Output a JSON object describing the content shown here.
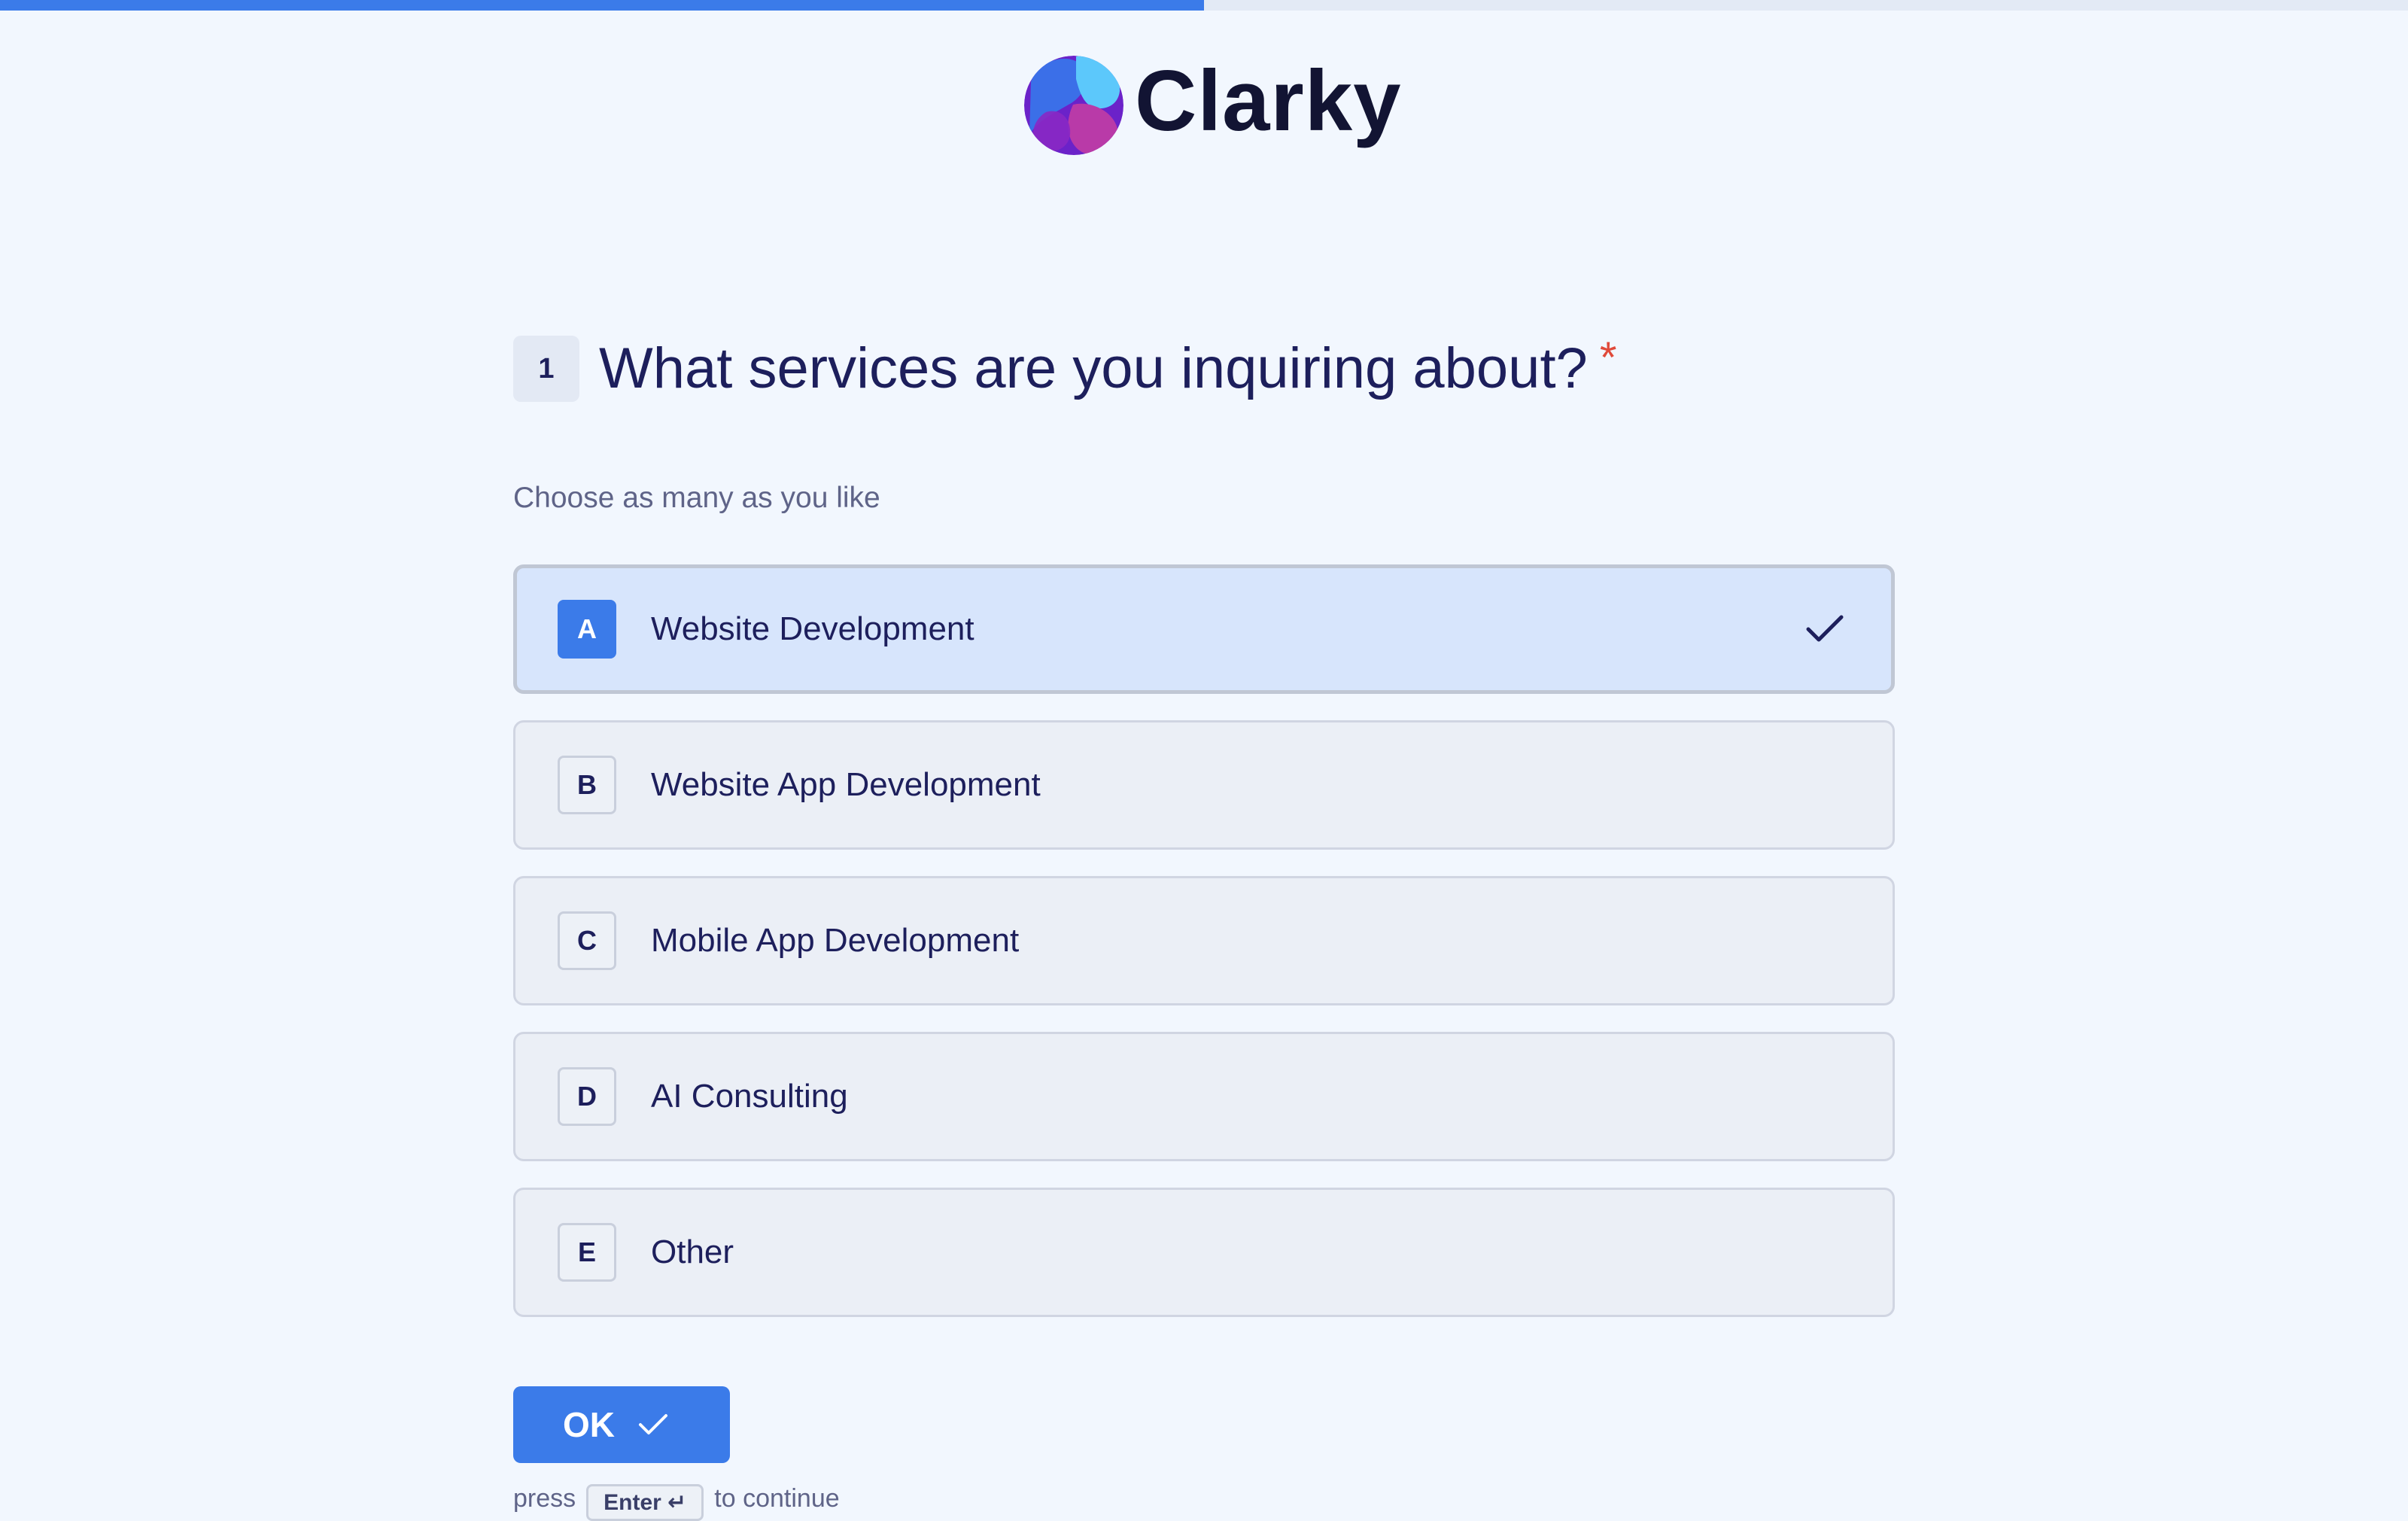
{
  "progress": {
    "fraction": 0.5
  },
  "brand": {
    "name": "Clarky",
    "logo_icon": "clarky-logo-mark",
    "logo_colors": [
      "#3b82f6",
      "#5cc8fb",
      "#7b2fd1",
      "#c33bb0"
    ]
  },
  "question": {
    "number": "1",
    "title": "What services are you inquiring about?",
    "required_mark": "*",
    "hint": "Choose as many as you like"
  },
  "options": [
    {
      "key": "A",
      "label": "Website Development",
      "selected": true
    },
    {
      "key": "B",
      "label": "Website App Development",
      "selected": false
    },
    {
      "key": "C",
      "label": "Mobile App Development",
      "selected": false
    },
    {
      "key": "D",
      "label": "AI Consulting",
      "selected": false
    },
    {
      "key": "E",
      "label": "Other",
      "selected": false
    }
  ],
  "ok_button": {
    "label": "OK",
    "icon": "check-icon"
  },
  "enter_hint": {
    "prefix": "press",
    "key": "Enter ↵",
    "suffix": "to continue"
  },
  "colors": {
    "accent": "#3b7be9",
    "background": "#f2f7fe",
    "text": "#1d1f5c",
    "required": "#e04a3a",
    "selected_option_bg": "#d7e5fc",
    "option_bg": "#ebeff6"
  }
}
